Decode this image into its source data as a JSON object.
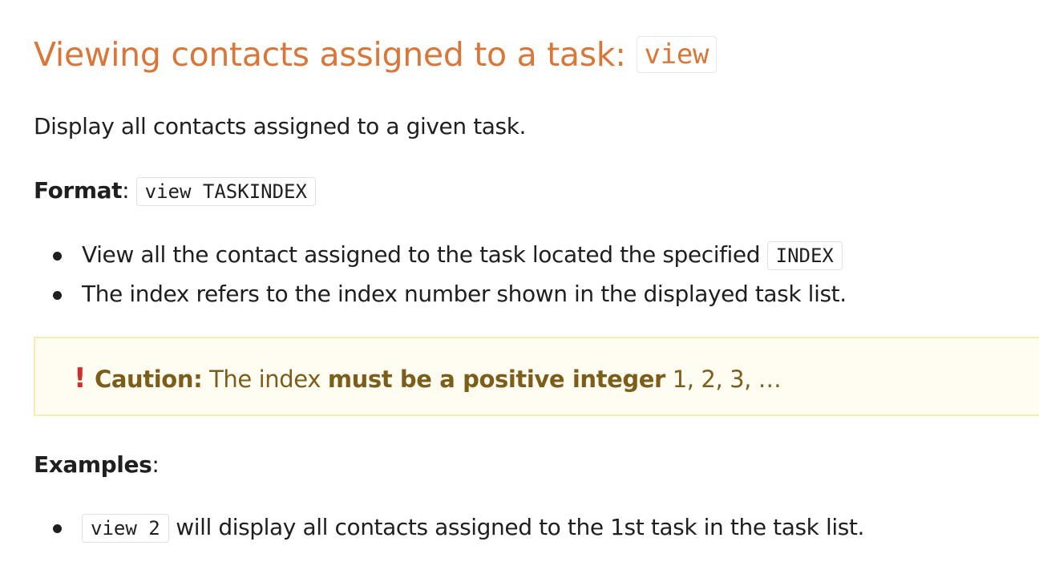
{
  "heading": {
    "text": "Viewing contacts assigned to a task: ",
    "code": "view"
  },
  "description": "Display all contacts assigned to a given task.",
  "format": {
    "label": "Format",
    "colon": ":",
    "code": "view TASKINDEX"
  },
  "bullets": [
    {
      "text": "View all the contact assigned to the task located the specified ",
      "code": "INDEX"
    },
    {
      "text": "The index refers to the index number shown in the displayed task list."
    }
  ],
  "caution": {
    "icon": "exclamation-icon",
    "label": "Caution:",
    "text_before": " The index ",
    "emphasis": "must be a positive integer",
    "text_after": " 1, 2, 3, …",
    "colors": {
      "border": "#f7ecb8",
      "background": "#fffdf2",
      "text": "#7d5d1a",
      "icon": "#d62b2b"
    }
  },
  "examples": {
    "label": "Examples",
    "colon": ":",
    "items": [
      {
        "code": "view 2",
        "text": " will display all contacts assigned to the 1st task in the task list."
      }
    ]
  },
  "colors": {
    "heading": "#d9773a",
    "text": "#1f1f1f"
  }
}
